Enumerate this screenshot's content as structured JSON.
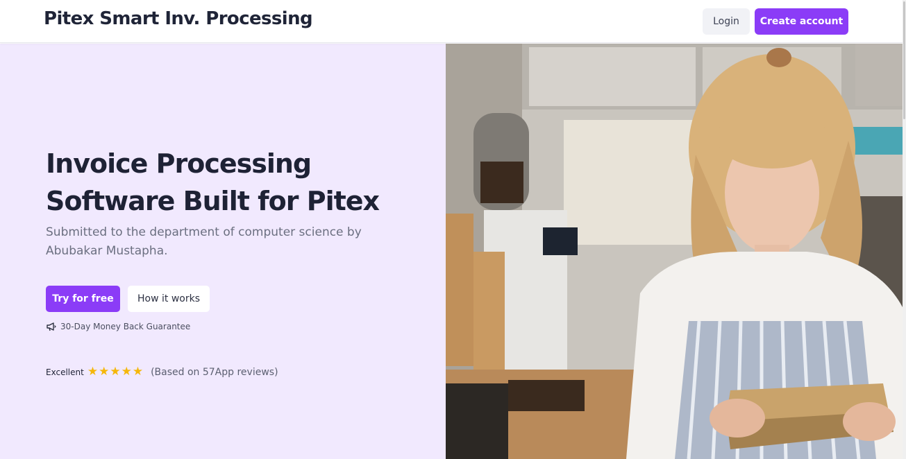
{
  "header": {
    "brand": "Pitex Smart Inv. Processing",
    "login_label": "Login",
    "create_account_label": "Create account"
  },
  "hero": {
    "title_line1": "Invoice Processing",
    "title_line2": "Software Built for Pitex",
    "subtitle_line1": "Submitted to the department of computer science by",
    "subtitle_line2": "Abubakar Mustapha.",
    "try_label": "Try for free",
    "how_label": "How it works",
    "guarantee_icon": "megaphone-icon",
    "guarantee_text": "30-Day Money Back Guarantee",
    "rating_label": "Excellent",
    "rating_stars": 5,
    "rating_reviews": "(Based on 57App reviews)"
  },
  "colors": {
    "accent": "#8b3cf7",
    "hero_bg": "#f1e9fe",
    "star": "#f5b70a"
  }
}
